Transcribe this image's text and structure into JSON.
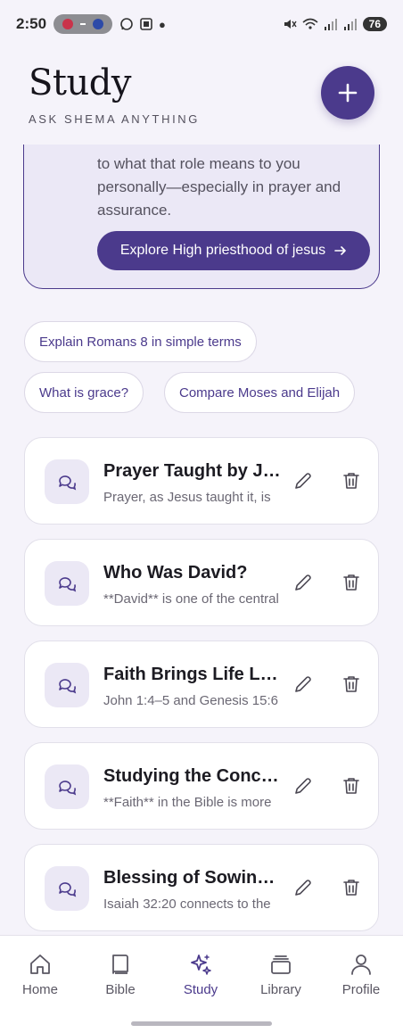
{
  "status": {
    "time": "2:50",
    "battery": "76"
  },
  "header": {
    "title": "Study",
    "subtitle": "ASK SHEMA ANYTHING"
  },
  "topic_card": {
    "text": "to what that role means to you personally—especially in prayer and assurance.",
    "explore_label": "Explore High priesthood of jesus"
  },
  "suggestions": [
    "Explain Romans 8 in simple terms",
    "What is grace?",
    "Compare Moses and Elijah"
  ],
  "sessions": [
    {
      "title": "Prayer Taught by Jesus",
      "preview": "Prayer, as Jesus taught it, is"
    },
    {
      "title": "Who Was David?",
      "preview": "**David** is one of the central"
    },
    {
      "title": "Faith Brings Life Light",
      "preview": "John 1:4–5 and Genesis 15:6"
    },
    {
      "title": "Studying the Concept of Faith",
      "preview": "**Faith** in the Bible is more"
    },
    {
      "title": "Blessing of Sowing Seed",
      "preview": "Isaiah 32:20 connects to the"
    }
  ],
  "nav": [
    {
      "label": "Home",
      "icon": "home-icon"
    },
    {
      "label": "Bible",
      "icon": "book-icon"
    },
    {
      "label": "Study",
      "icon": "sparkles-icon"
    },
    {
      "label": "Library",
      "icon": "library-icon"
    },
    {
      "label": "Profile",
      "icon": "user-icon"
    }
  ],
  "colors": {
    "accent": "#4b3a8c",
    "background": "#f5f3fa",
    "card_tint": "#ebe8f6"
  }
}
